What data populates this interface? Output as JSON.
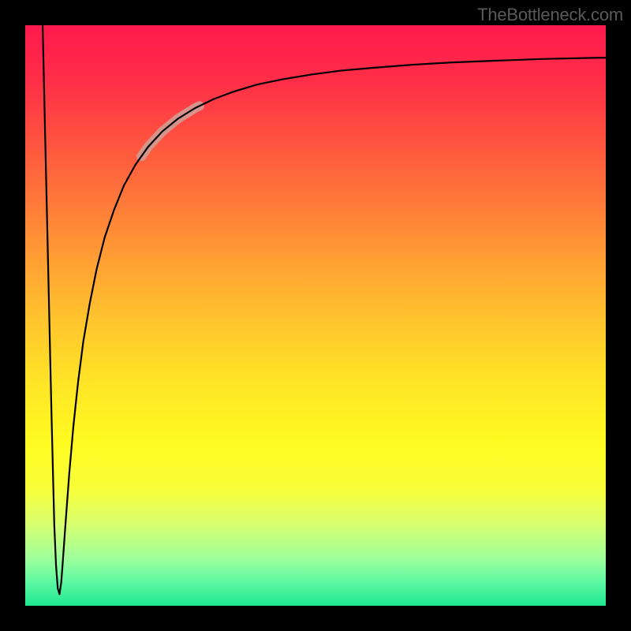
{
  "watermark": {
    "text": "TheBottleneck.com"
  },
  "gradient": {
    "stops": [
      {
        "offset": 0.0,
        "color": "#ff1a4d"
      },
      {
        "offset": 0.1,
        "color": "#ff2f47"
      },
      {
        "offset": 0.22,
        "color": "#ff5a3e"
      },
      {
        "offset": 0.35,
        "color": "#ff8a36"
      },
      {
        "offset": 0.5,
        "color": "#ffc22e"
      },
      {
        "offset": 0.62,
        "color": "#ffe626"
      },
      {
        "offset": 0.72,
        "color": "#fffb20"
      },
      {
        "offset": 0.8,
        "color": "#f7ff3a"
      },
      {
        "offset": 0.86,
        "color": "#d8ff70"
      },
      {
        "offset": 0.92,
        "color": "#9cff9c"
      },
      {
        "offset": 0.96,
        "color": "#5cf7a3"
      },
      {
        "offset": 1.0,
        "color": "#1fe88f"
      }
    ]
  },
  "curve_style": {
    "stroke": "#000000",
    "stroke_width": 2.2,
    "highlight_color": "#d09c93",
    "highlight_width": 12
  },
  "chart_data": {
    "type": "line",
    "title": "",
    "xlabel": "",
    "ylabel": "",
    "xlim": [
      0,
      100
    ],
    "ylim": [
      0,
      100
    ],
    "grid": false,
    "notes": "Axes have no visible tick labels. x,y are read from plot-area fractions then mapped to 0–100. y is displayed inverted (0 at top, 100 at bottom). Left branch starts near (~3, 0) falling to a sharp minimum near (~6, 98), then rises toward an asymptote near y≈5 at x=100. Pale segment highlights roughly x∈[20,30] on the rising branch.",
    "series": [
      {
        "name": "curve",
        "x": [
          3.0,
          3.5,
          4.0,
          4.5,
          5.0,
          5.3,
          5.6,
          5.9,
          6.2,
          6.5,
          7.0,
          7.6,
          8.3,
          9.1,
          10.0,
          11.1,
          12.3,
          13.7,
          15.3,
          17.0,
          19.0,
          21.2,
          23.6,
          26.3,
          29.2,
          32.5,
          36.0,
          40.0,
          44.4,
          49.2,
          54.5,
          60.3,
          66.7,
          73.6,
          81.2,
          89.5,
          98.6,
          100.0
        ],
        "y": [
          0.0,
          22.0,
          44.0,
          66.0,
          86.0,
          93.0,
          97.0,
          98.0,
          96.0,
          92.0,
          85.0,
          77.0,
          69.0,
          61.5,
          54.5,
          48.0,
          42.0,
          36.5,
          31.8,
          27.6,
          24.0,
          20.9,
          18.3,
          16.1,
          14.3,
          12.7,
          11.4,
          10.2,
          9.3,
          8.5,
          7.8,
          7.3,
          6.8,
          6.4,
          6.1,
          5.8,
          5.6,
          5.6
        ]
      }
    ],
    "highlight": {
      "series": "curve",
      "x_start": 20.0,
      "x_end": 30.0
    }
  }
}
